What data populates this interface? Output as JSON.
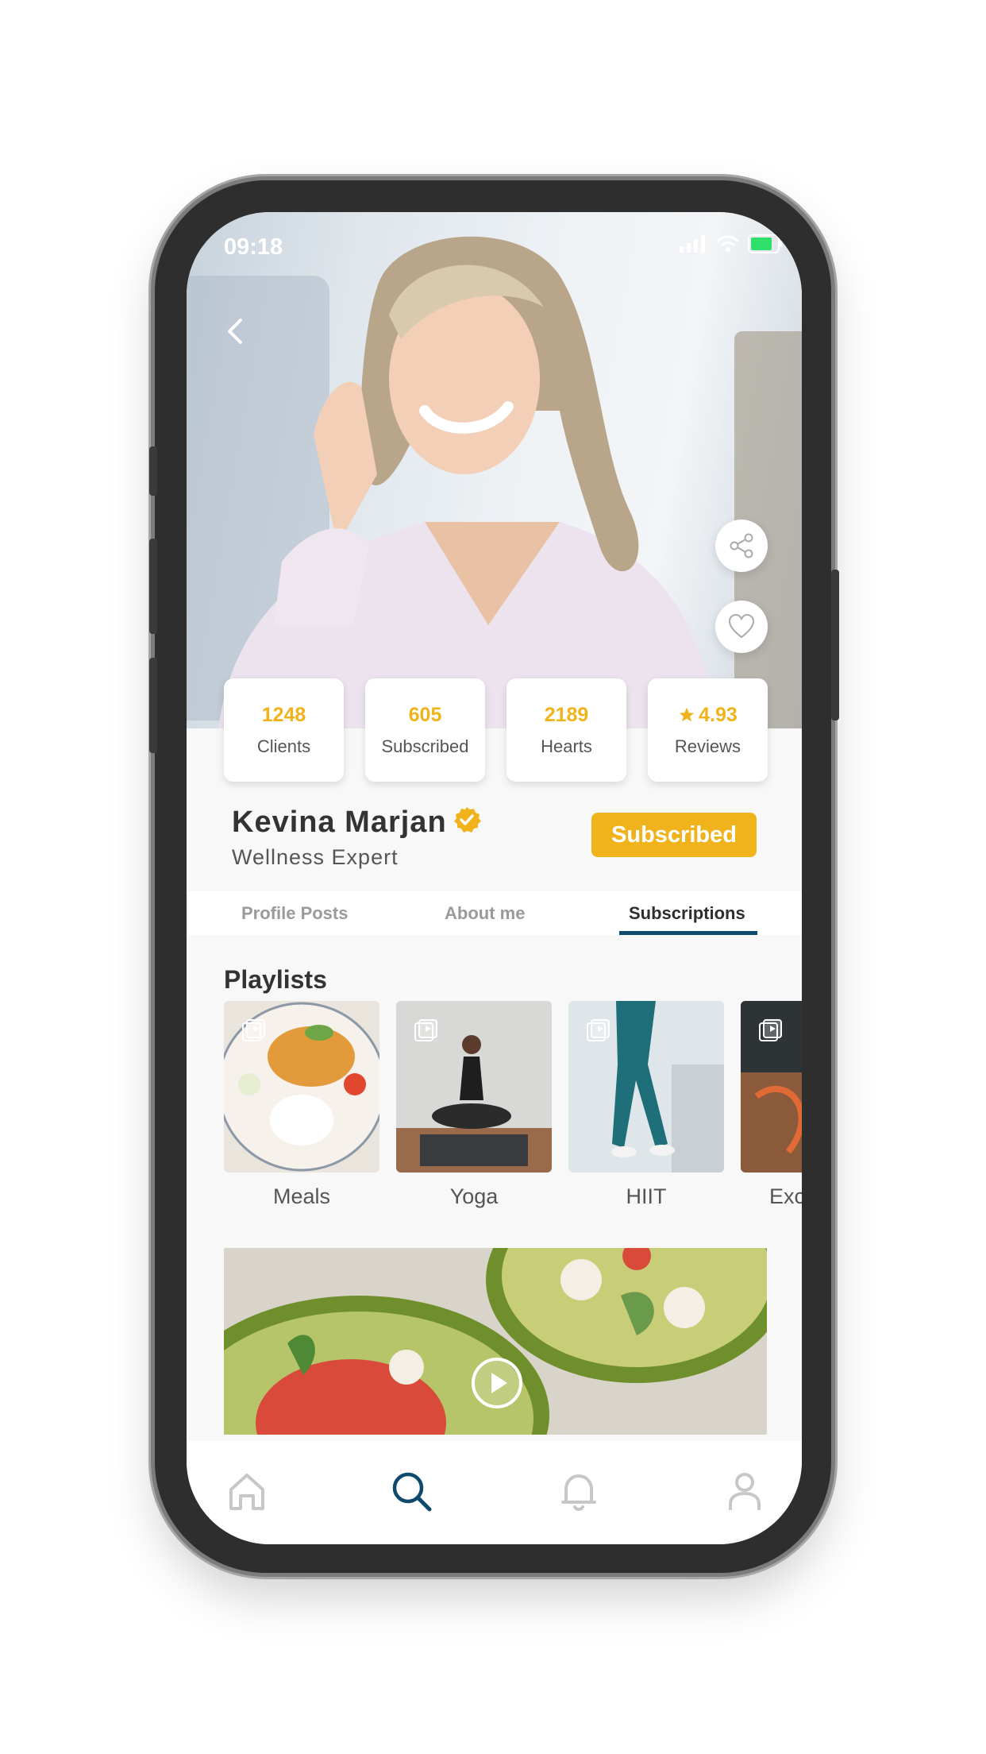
{
  "status_bar": {
    "time": "09:18"
  },
  "colors": {
    "accent": "#f0b31c",
    "primary": "#0d4a6b",
    "battery": "#2ee06a"
  },
  "stats": [
    {
      "value": "1248",
      "label": "Clients"
    },
    {
      "value": "605",
      "label": "Subscribed"
    },
    {
      "value": "2189",
      "label": "Hearts"
    },
    {
      "value": "4.93",
      "label": "Reviews"
    }
  ],
  "profile": {
    "name": "Kevina Marjan",
    "role": "Wellness Expert",
    "subscribe_label": "Subscribed"
  },
  "tabs": [
    {
      "label": "Profile Posts"
    },
    {
      "label": "About me"
    },
    {
      "label": "Subscriptions"
    }
  ],
  "active_tab": "Subscriptions",
  "playlists": {
    "title": "Playlists",
    "items": [
      {
        "label": "Meals"
      },
      {
        "label": "Yoga"
      },
      {
        "label": "HIIT"
      },
      {
        "label": "Exc"
      }
    ]
  },
  "nav": [
    "home-icon",
    "search-icon",
    "bell-icon",
    "user-icon"
  ]
}
